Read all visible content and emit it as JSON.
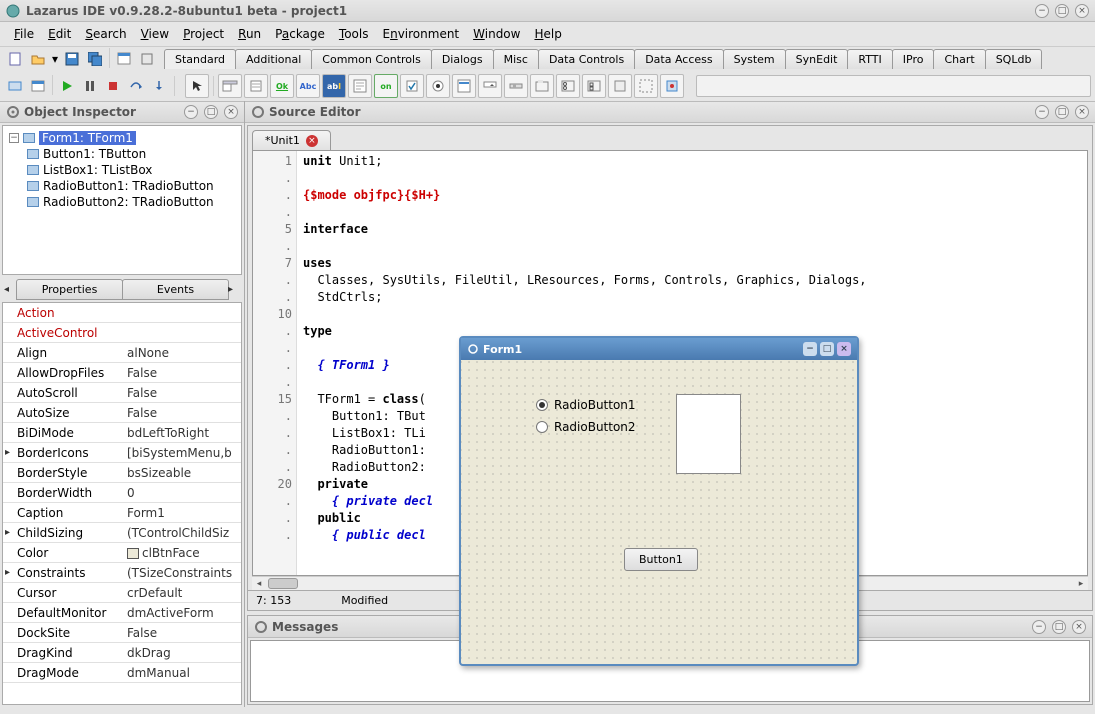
{
  "main_title": "Lazarus IDE v0.9.28.2-8ubuntu1 beta - project1",
  "menus": [
    "File",
    "Edit",
    "Search",
    "View",
    "Project",
    "Run",
    "Package",
    "Tools",
    "Environment",
    "Window",
    "Help"
  ],
  "component_tabs": [
    "Standard",
    "Additional",
    "Common Controls",
    "Dialogs",
    "Misc",
    "Data Controls",
    "Data Access",
    "System",
    "SynEdit",
    "RTTI",
    "IPro",
    "Chart",
    "SQLdb"
  ],
  "palette_icons": [
    "arrow",
    "menu",
    "popup",
    "Ok",
    "Abc",
    "abI",
    "edit",
    "on",
    "check",
    "radio",
    "list",
    "combo",
    "scroll",
    "group",
    "panel",
    "frame",
    "bevel",
    "image",
    "shape"
  ],
  "inspector_title": "Object Inspector",
  "tree": {
    "root": "Form1: TForm1",
    "children": [
      "Button1: TButton",
      "ListBox1: TListBox",
      "RadioButton1: TRadioButton",
      "RadioButton2: TRadioButton"
    ]
  },
  "prop_tabs": [
    "Properties",
    "Events"
  ],
  "properties": [
    {
      "name": "Action",
      "val": "",
      "red": true
    },
    {
      "name": "ActiveControl",
      "val": "",
      "red": true
    },
    {
      "name": "Align",
      "val": "alNone"
    },
    {
      "name": "AllowDropFiles",
      "val": "False"
    },
    {
      "name": "AutoScroll",
      "val": "False"
    },
    {
      "name": "AutoSize",
      "val": "False"
    },
    {
      "name": "BiDiMode",
      "val": "bdLeftToRight"
    },
    {
      "name": "BorderIcons",
      "val": "[biSystemMenu,b",
      "exp": true
    },
    {
      "name": "BorderStyle",
      "val": "bsSizeable"
    },
    {
      "name": "BorderWidth",
      "val": "0"
    },
    {
      "name": "Caption",
      "val": "Form1"
    },
    {
      "name": "ChildSizing",
      "val": "(TControlChildSiz",
      "exp": true
    },
    {
      "name": "Color",
      "val": "clBtnFace",
      "color": true
    },
    {
      "name": "Constraints",
      "val": "(TSizeConstraints",
      "exp": true
    },
    {
      "name": "Cursor",
      "val": "crDefault"
    },
    {
      "name": "DefaultMonitor",
      "val": "dmActiveForm"
    },
    {
      "name": "DockSite",
      "val": "False"
    },
    {
      "name": "DragKind",
      "val": "dkDrag"
    },
    {
      "name": "DragMode",
      "val": "dmManual"
    }
  ],
  "source_title": "Source Editor",
  "editor_tab": "*Unit1",
  "gutter_lines": [
    "1",
    ".",
    ".",
    ".",
    "5",
    ".",
    "7",
    ".",
    ".",
    "10",
    ".",
    ".",
    ".",
    ".",
    "15",
    ".",
    ".",
    ".",
    ".",
    "20",
    ".",
    ".",
    "."
  ],
  "status": {
    "pos": "7: 153",
    "state": "Modified"
  },
  "messages_title": "Messages",
  "form": {
    "title": "Form1",
    "radio1": "RadioButton1",
    "radio2": "RadioButton2",
    "button": "Button1"
  }
}
